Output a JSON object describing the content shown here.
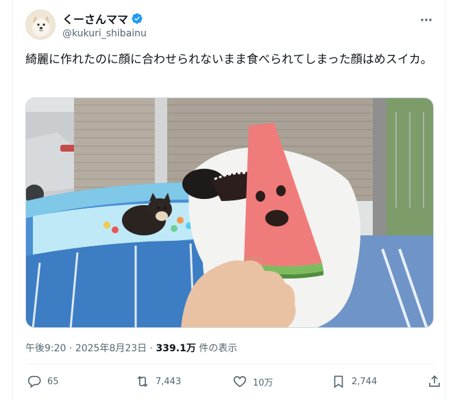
{
  "author": {
    "display_name": "くーさんママ",
    "handle": "@kukuri_shibainu",
    "verified": true
  },
  "tweet": {
    "text": "綺麗に作れたのに顔に合わせられないまま食べられてしまった顔はめスイカ。"
  },
  "meta": {
    "time": "午後9:20",
    "separator": "·",
    "date": "2025年8月23日",
    "views_count": "339.1万",
    "views_label": "件の表示"
  },
  "actions": {
    "reply_count": "65",
    "retweet_count": "7,443",
    "like_count": "10万",
    "bookmark_count": "2,744"
  },
  "icons": {
    "verified": "verified-badge-icon",
    "more": "more-icon",
    "reply": "reply-icon",
    "retweet": "retweet-icon",
    "like": "heart-icon",
    "bookmark": "bookmark-icon",
    "share": "share-icon"
  },
  "colors": {
    "verified_blue": "#1d9bf0",
    "secondary_text": "#536471",
    "primary_text": "#0f1419"
  }
}
